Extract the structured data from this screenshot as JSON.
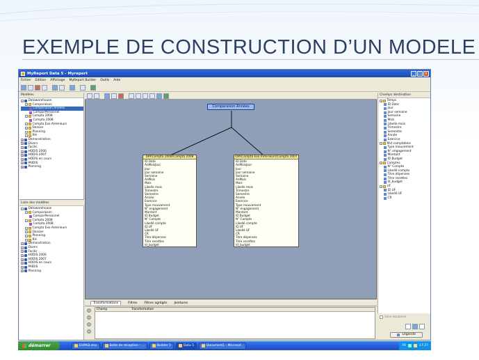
{
  "slide": {
    "title": "EXEMPLE DE CONSTRUCTION D’UN MODELE"
  },
  "window": {
    "title": "MyReport Data 5 - Myreport",
    "menu": [
      "Fichier",
      "Edition",
      "Affichage",
      "MyReport Builder",
      "Outils",
      "Aide"
    ]
  },
  "left": {
    "models_header": "Modèles",
    "models_tree": [
      {
        "label": "Datawarehouse",
        "icon": "db",
        "level": 0
      },
      {
        "label": "Comparaison",
        "icon": "folder",
        "level": 1
      },
      {
        "label": "Comparaison Années",
        "icon": "model",
        "level": 2,
        "selected": true
      },
      {
        "label": "ComparPersonnel",
        "icon": "model",
        "level": 2
      },
      {
        "label": "Compta 2008",
        "icon": "folder",
        "level": 1
      },
      {
        "label": "Compta 2008",
        "icon": "model",
        "level": 2
      },
      {
        "label": "Compta Exo Anterieurs",
        "icon": "folder",
        "level": 1
      },
      {
        "label": "Dossier",
        "icon": "folder",
        "level": 1
      },
      {
        "label": "Planning",
        "icon": "folder",
        "level": 1
      },
      {
        "label": "RH",
        "icon": "folder",
        "level": 1
      },
      {
        "label": "Demonstration",
        "icon": "db",
        "level": 0
      },
      {
        "label": "Divers",
        "icon": "db",
        "level": 0
      },
      {
        "label": "Facilis",
        "icon": "db",
        "level": 0
      },
      {
        "label": "HODIS 2006",
        "icon": "db",
        "level": 0
      },
      {
        "label": "HODIS 2007",
        "icon": "db",
        "level": 0
      },
      {
        "label": "HODIS en cours",
        "icon": "db",
        "level": 0
      },
      {
        "label": "PAIDIS",
        "icon": "db",
        "level": 0
      },
      {
        "label": "Planning",
        "icon": "db",
        "level": 0
      }
    ],
    "list_header": "Liste des modèles",
    "list_tree": [
      {
        "label": "Datawarehouse",
        "icon": "db",
        "level": 0
      },
      {
        "label": "Comparaison",
        "icon": "folder",
        "level": 1
      },
      {
        "label": "ComparPersonnel",
        "icon": "model",
        "level": 2
      },
      {
        "label": "Compta 2008",
        "icon": "folder",
        "level": 1
      },
      {
        "label": "Compta 2008",
        "icon": "model",
        "level": 2
      },
      {
        "label": "Compta Exo Anterieurs",
        "icon": "folder",
        "level": 1
      },
      {
        "label": "Dossier",
        "icon": "folder",
        "level": 1
      },
      {
        "label": "Planning",
        "icon": "folder",
        "level": 1
      },
      {
        "label": "RH",
        "icon": "folder",
        "level": 1
      },
      {
        "label": "Demonstration",
        "icon": "db",
        "level": 0
      },
      {
        "label": "Divers",
        "icon": "db",
        "level": 0
      },
      {
        "label": "Facilis",
        "icon": "db",
        "level": 0
      },
      {
        "label": "HODIS 2006",
        "icon": "db",
        "level": 0
      },
      {
        "label": "HODIS 2007",
        "icon": "db",
        "level": 0
      },
      {
        "label": "HODIS en cours",
        "icon": "db",
        "level": 0
      },
      {
        "label": "PAIDIS",
        "icon": "db",
        "level": 0
      },
      {
        "label": "Planning",
        "icon": "db",
        "level": 0
      }
    ]
  },
  "diagram": {
    "root": "Comparaison Années",
    "table1": {
      "title": "DIA\\Compta 2008\\Compta 2008",
      "fields": [
        "ID Date",
        "AnMoisJour",
        "Jour",
        "Jour semaine",
        "Semaine",
        "AnMois",
        "Mois",
        "Libelle mois",
        "Trimestre",
        "Semestre",
        "Année",
        "Exercice",
        "Type mouvement",
        "N° engagement",
        "Montant",
        "ID Budget",
        "N° Compte",
        "Libellé compte",
        "ID UF",
        "Libellé UF",
        "CR",
        "Titre dépenses",
        "Titre recettes",
        "Id_budget"
      ]
    },
    "table2": {
      "title": "DIA\\Compta Exo Anterieurs\\Compta 2007",
      "fields": [
        "ID Date",
        "AnMoisJour",
        "Jour",
        "Jour semaine",
        "Semaine",
        "AnMois",
        "Mois",
        "Libelle mois",
        "Trimestre",
        "Semestre",
        "Année",
        "Exercice",
        "Type mouvement",
        "N° engagement",
        "Montant",
        "ID Budget",
        "N° Compte",
        "Libellé compte",
        "ID UF",
        "Libellé UF",
        "CR",
        "Titre dépenses",
        "Titre recettes",
        "Id_budget"
      ]
    }
  },
  "bottom": {
    "tabs": [
      "Transformations",
      "Filtres",
      "Filtres agrégés",
      "Jointures"
    ],
    "columns": [
      "Champ",
      "Transformation"
    ]
  },
  "right": {
    "header": "Champs destination",
    "tree": [
      {
        "label": "Temps",
        "icon": "folder",
        "level": 0
      },
      {
        "label": "ID Date",
        "icon": "field",
        "level": 1
      },
      {
        "label": "Jour",
        "icon": "field",
        "level": 1
      },
      {
        "label": "Jour semaine",
        "icon": "field",
        "level": 1
      },
      {
        "label": "Semaine",
        "icon": "field",
        "level": 1
      },
      {
        "label": "Mois",
        "icon": "field",
        "level": 1
      },
      {
        "label": "Libelle mois",
        "icon": "field",
        "level": 1
      },
      {
        "label": "Trimestre",
        "icon": "field",
        "level": 1
      },
      {
        "label": "Semestre",
        "icon": "field",
        "level": 1
      },
      {
        "label": "Année",
        "icon": "field",
        "level": 1
      },
      {
        "label": "Exercice",
        "icon": "field",
        "level": 1
      },
      {
        "label": "Mvt comptables",
        "icon": "folder",
        "level": 0
      },
      {
        "label": "Type mouvement",
        "icon": "field",
        "level": 1
      },
      {
        "label": "N° engagement",
        "icon": "field",
        "level": 1
      },
      {
        "label": "Montant",
        "icon": "field",
        "level": 1
      },
      {
        "label": "ID Budget",
        "icon": "field",
        "level": 1
      },
      {
        "label": "Comptes",
        "icon": "folder",
        "level": 0
      },
      {
        "label": "N° Compte",
        "icon": "field",
        "level": 1
      },
      {
        "label": "Libellé compte",
        "icon": "field",
        "level": 1
      },
      {
        "label": "Titre dépenses",
        "icon": "field",
        "level": 1
      },
      {
        "label": "Titre recettes",
        "icon": "field",
        "level": 1
      },
      {
        "label": "Id_budget",
        "icon": "field",
        "level": 1
      },
      {
        "label": "UF",
        "icon": "folder",
        "level": 0
      },
      {
        "label": "ID UF",
        "icon": "field",
        "level": 1
      },
      {
        "label": "Libellé UF",
        "icon": "field",
        "level": 1
      },
      {
        "label": "CR",
        "icon": "field",
        "level": 1
      }
    ],
    "checkbox_label": "Sans doublons",
    "legend_button": "Légende"
  },
  "taskbar": {
    "start": "démarrer",
    "tasks": [
      "EHPAD.xlsx",
      "Boîte de réception - ...",
      "Builder 5",
      "Data 5",
      "Document1 - Microsof..."
    ],
    "active_task": 3,
    "lang": "FR",
    "time": "17:27"
  }
}
